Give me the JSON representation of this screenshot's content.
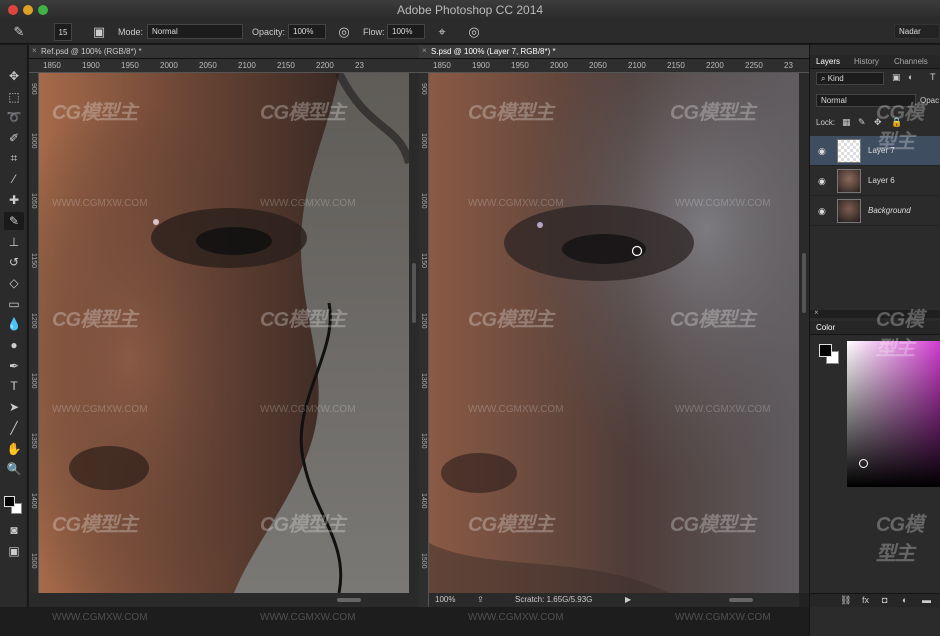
{
  "window": {
    "title": "Adobe Photoshop CC 2014",
    "workspace": "Nadar"
  },
  "options_bar": {
    "brush_size": "15",
    "mode_label": "Mode:",
    "mode_value": "Normal",
    "opacity_label": "Opacity:",
    "opacity_value": "100%",
    "flow_label": "Flow:",
    "flow_value": "100%"
  },
  "doc_ref": {
    "tab": "Ref.psd @ 100% (RGB/8*) *",
    "ruler_h": [
      "1850",
      "1900",
      "1950",
      "2000",
      "2050",
      "2100",
      "2150",
      "2200",
      "23"
    ]
  },
  "doc_main": {
    "tab": "S.psd @ 100% (Layer 7, RGB/8*) *",
    "ruler_h": [
      "1850",
      "1900",
      "1950",
      "2000",
      "2050",
      "2100",
      "2150",
      "2200",
      "2250",
      "23"
    ],
    "zoom": "100%",
    "scratch": "Scratch: 1.65G/5.93G"
  },
  "layers_panel": {
    "tabs": [
      "Layers",
      "History",
      "Channels"
    ],
    "kind": "Kind",
    "blend_mode": "Normal",
    "opacity_cut": "Opac",
    "lock_label": "Lock:",
    "layers": [
      {
        "name": "Layer 7",
        "selected": true
      },
      {
        "name": "Layer 6",
        "selected": false
      },
      {
        "name": "Background",
        "selected": false
      }
    ]
  },
  "color_panel": {
    "title": "Color",
    "spectrum_color": "#d23ad0"
  },
  "watermark": {
    "logo": "CG模型主",
    "url": "WWW.CGMXW.COM"
  },
  "colors": {
    "selected_layer": "#3f4d60",
    "panel_bg": "#2b2b2b"
  }
}
